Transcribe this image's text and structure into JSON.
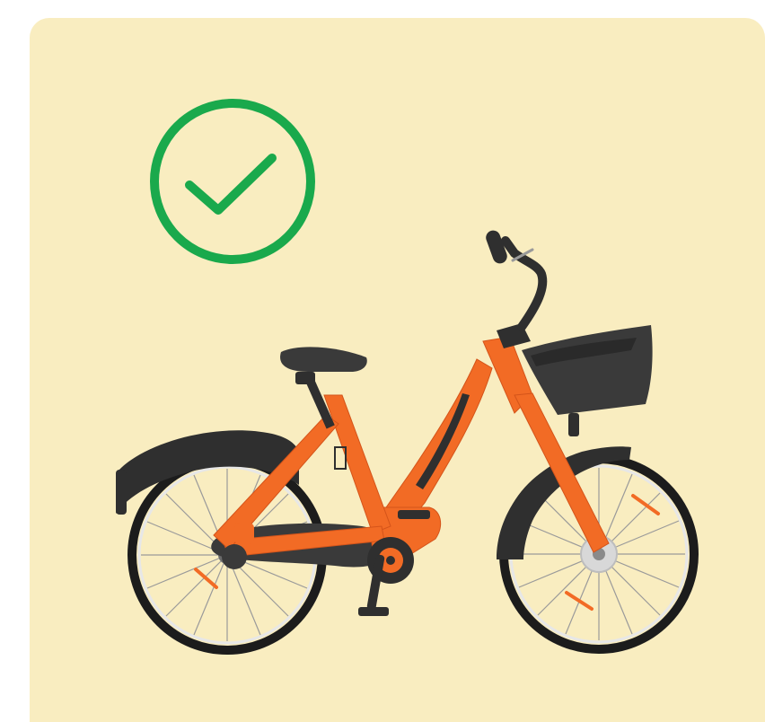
{
  "illustration": {
    "background_color": "#f9edc0",
    "check_icon": "check-circle-icon",
    "check_color": "#1aa94c",
    "bike_icon": "e-bike-icon",
    "bike_frame_color": "#f26b25",
    "bike_dark_color": "#2f2f2f",
    "bike_tyre_color": "#1c1c1c",
    "bike_wheel_color": "#d8d8d8"
  }
}
